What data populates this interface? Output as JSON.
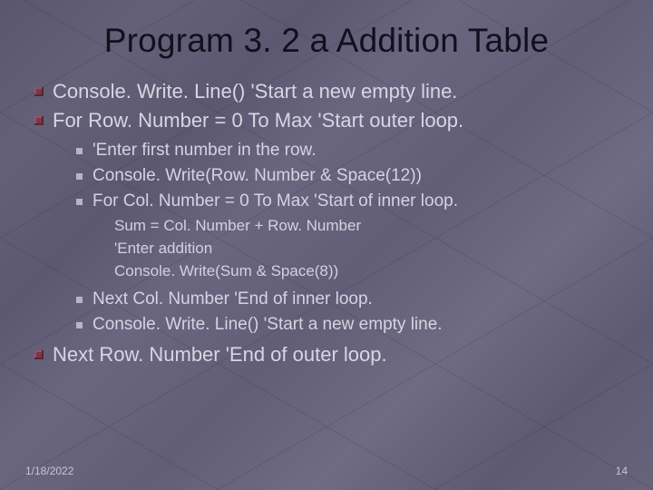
{
  "title": "Program 3. 2 a Addition Table",
  "bullets_lvl1_top": [
    "Console. Write. Line() 'Start a new empty line.",
    "For Row. Number = 0 To Max 'Start outer loop."
  ],
  "bullets_lvl2_a": [
    "'Enter first number in the row.",
    "Console. Write(Row. Number & Space(12))",
    "For Col. Number = 0 To Max 'Start of inner loop."
  ],
  "bullets_lvl3": [
    "Sum = Col. Number + Row. Number",
    "'Enter addition",
    "Console. Write(Sum & Space(8))"
  ],
  "bullets_lvl2_b": [
    "Next Col. Number 'End of inner loop.",
    "Console. Write. Line() 'Start a new empty line."
  ],
  "bullets_lvl1_bottom": [
    "Next Row. Number 'End of outer loop."
  ],
  "footer": {
    "date": "1/18/2022",
    "page": "14"
  }
}
